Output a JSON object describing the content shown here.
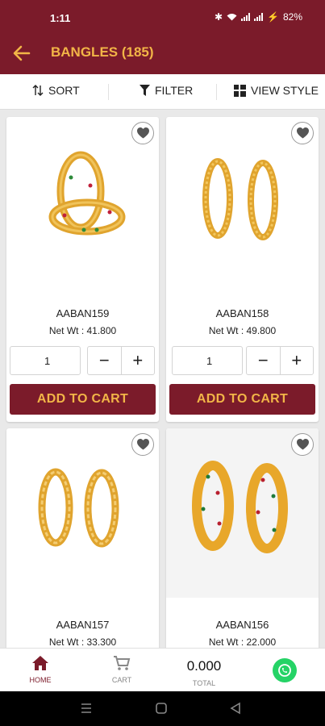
{
  "status": {
    "time": "1:11",
    "battery": "82%"
  },
  "appbar": {
    "title": "BANGLES (185)"
  },
  "toolbar": {
    "sort": "SORT",
    "filter": "FILTER",
    "view_style": "VIEW STYLE"
  },
  "products": [
    {
      "sku": "AABAN159",
      "net_wt": "Net Wt : 41.800",
      "qty": "1",
      "add_label": "ADD TO CART"
    },
    {
      "sku": "AABAN158",
      "net_wt": "Net Wt : 49.800",
      "qty": "1",
      "add_label": "ADD TO CART"
    },
    {
      "sku": "AABAN157",
      "net_wt": "Net Wt : 33.300"
    },
    {
      "sku": "AABAN156",
      "net_wt": "Net Wt : 22.000"
    }
  ],
  "bottom_nav": {
    "home": "HOME",
    "cart": "CART",
    "total_value": "0.000",
    "total": "TOTAL"
  },
  "colors": {
    "brand": "#7b1b2a",
    "accent": "#f2b547",
    "whatsapp": "#25d366"
  },
  "icons": [
    "back-arrow-icon",
    "sort-icon",
    "filter-icon",
    "grid-view-icon",
    "heart-icon",
    "home-icon",
    "cart-icon",
    "whatsapp-icon"
  ]
}
